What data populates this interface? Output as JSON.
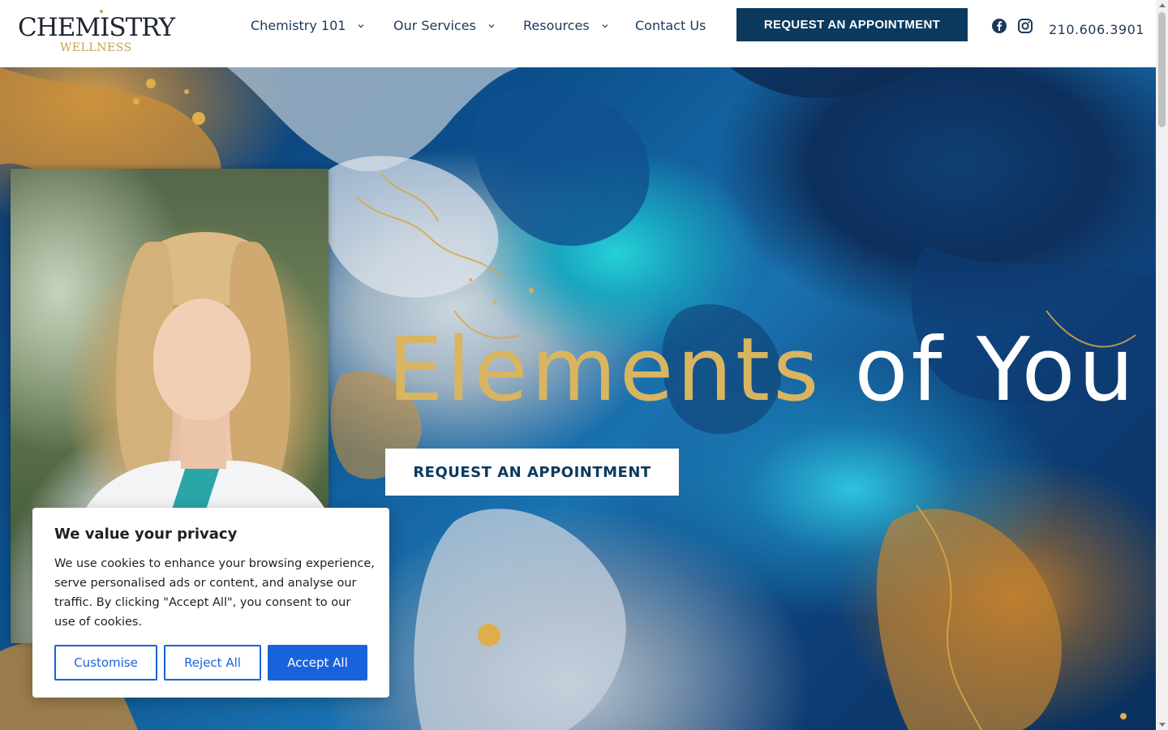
{
  "brand": {
    "logo_main": "CHEMISTRY",
    "logo_sub": "WELLNESS",
    "gold": "#c9a050",
    "navy": "#0c3a5e"
  },
  "nav": {
    "items": [
      {
        "label": "Chemistry 101",
        "has_dropdown": true
      },
      {
        "label": "Our Services",
        "has_dropdown": true
      },
      {
        "label": "Resources",
        "has_dropdown": true
      },
      {
        "label": "Contact Us",
        "has_dropdown": false
      }
    ],
    "cta_label": "REQUEST AN APPOINTMENT",
    "social": [
      {
        "icon": "facebook-icon"
      },
      {
        "icon": "instagram-icon"
      }
    ],
    "phone": "210.606.3901"
  },
  "hero": {
    "title_gold": "Elements",
    "title_white": "of You",
    "cta_label": "REQUEST AN APPOINTMENT"
  },
  "cookie": {
    "title": "We value your privacy",
    "text": "We use cookies to enhance your browsing experience, serve personalised ads or content, and analyse our traffic. By clicking \"Accept All\", you consent to our use of cookies.",
    "customise_label": "Customise",
    "reject_label": "Reject All",
    "accept_label": "Accept All",
    "accent": "#1863dc"
  }
}
